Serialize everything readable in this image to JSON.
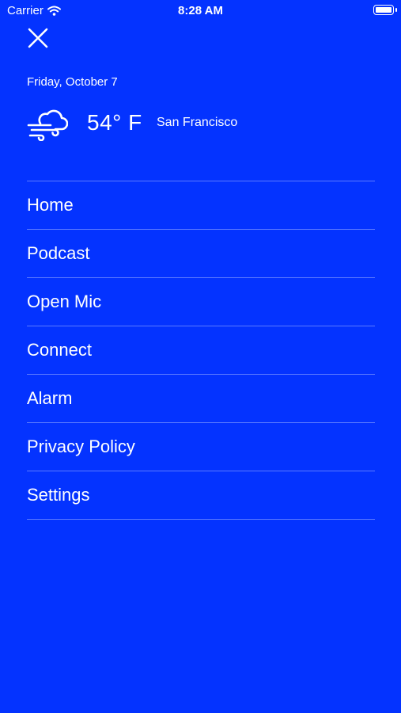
{
  "status_bar": {
    "carrier": "Carrier",
    "time": "8:28 AM"
  },
  "header": {
    "date": "Friday, October 7",
    "temperature": "54° F",
    "city": "San Francisco",
    "weather_icon": "wind-cloud-icon"
  },
  "menu": {
    "items": [
      {
        "label": "Home"
      },
      {
        "label": "Podcast"
      },
      {
        "label": "Open Mic"
      },
      {
        "label": "Connect"
      },
      {
        "label": "Alarm"
      },
      {
        "label": "Privacy Policy"
      },
      {
        "label": "Settings"
      }
    ]
  },
  "colors": {
    "background": "#0433ff",
    "text": "#ffffff"
  }
}
